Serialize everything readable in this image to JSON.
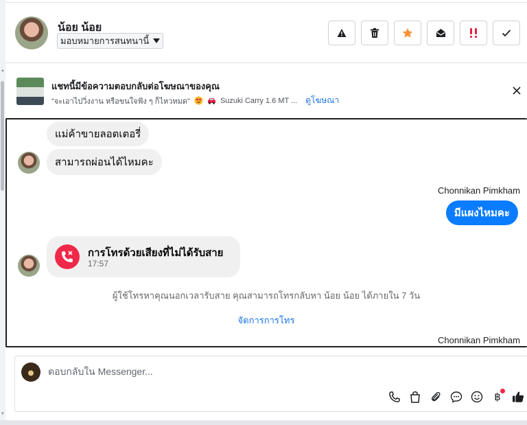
{
  "header": {
    "contact_name": "น้อย น้อย",
    "assign_label": "มอบหมายการสนทนานี้"
  },
  "ad_banner": {
    "title": "แชทนี้มีข้อความตอบกลับต่อโฆษณาของคุณ",
    "snippet": "\"จะเอาไปวิ่งงาน หรือขนใจฟัง ๆ ก็ไหวหมด\"",
    "car_text": "Suzuki Carry 1.6 MT ...",
    "link_label": "ดูโฆษณา"
  },
  "messages": {
    "incoming_1": "แม่ค้าขายลอตเตอรี่",
    "incoming_2": "สามารถผ่อนได้ไหมคะ",
    "sender_1": "Chonnikan Pimkham",
    "outgoing_1": "มีแผงไหมคะ",
    "call_title": "การโทรด้วยเสียงที่ไม่ได้รับสาย",
    "call_time": "17:57",
    "notice": "ผู้ใช้โทรหาคุณนอกเวลารับสาย คุณสามารถโทรกลับหา น้อย น้อย ได้ภายใน 7 วัน",
    "manage_calls": "จัดการการโทร",
    "sender_2": "Chonnikan Pimkham"
  },
  "composer": {
    "placeholder": "ตอบกลับใน Messenger..."
  },
  "colors": {
    "messenger_blue": "#0a7cff",
    "link_blue": "#1b74e4",
    "missed_call_red": "#f02849",
    "star_orange": "#f7923a",
    "important_red": "#e41e3f"
  }
}
